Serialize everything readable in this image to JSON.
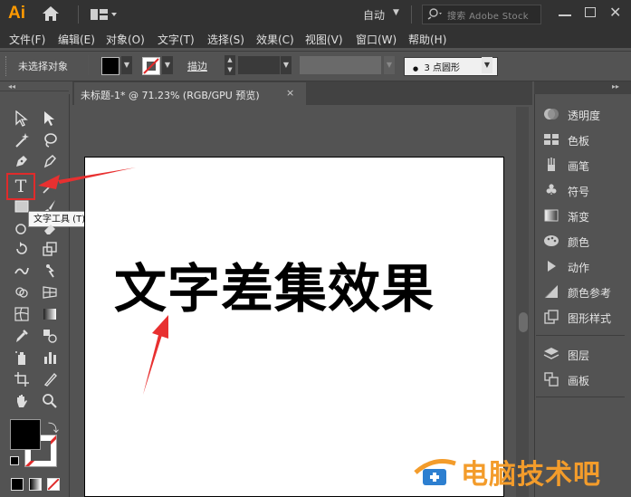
{
  "app": {
    "logo": "Ai",
    "workspace": "自动",
    "stock_search_placeholder": "搜索 Adobe Stock"
  },
  "menu": [
    "文件(F)",
    "编辑(E)",
    "对象(O)",
    "文字(T)",
    "选择(S)",
    "效果(C)",
    "视图(V)",
    "窗口(W)",
    "帮助(H)"
  ],
  "control": {
    "selection_status": "未选择对象",
    "stroke_label": "描边",
    "brush_size": "3",
    "brush_shape": "点圆形"
  },
  "document": {
    "tab_title": "未标题-1* @ 71.23% (RGB/GPU 预览)",
    "close": "×"
  },
  "tooltip": "文字工具 (T)",
  "artboard_text": "文字差集效果",
  "panels": [
    {
      "label": "透明度",
      "icon": "transparency-icon"
    },
    {
      "label": "色板",
      "icon": "swatches-icon"
    },
    {
      "label": "画笔",
      "icon": "brush-icon"
    },
    {
      "label": "符号",
      "icon": "symbol-club-icon"
    },
    {
      "label": "渐变",
      "icon": "gradient-icon"
    },
    {
      "label": "颜色",
      "icon": "color-palette-icon"
    },
    {
      "label": "动作",
      "icon": "play-icon"
    },
    {
      "label": "颜色参考",
      "icon": "color-guide-icon"
    },
    {
      "label": "图形样式",
      "icon": "graphic-styles-icon"
    },
    {
      "label": "图层",
      "icon": "layers-icon"
    },
    {
      "label": "画板",
      "icon": "artboards-icon"
    }
  ],
  "colors": {
    "accent_orange": "#ff9a00",
    "highlight_red": "#e02b2b",
    "watermark_orange": "#f39c2b"
  },
  "watermark": "电脑技术吧"
}
